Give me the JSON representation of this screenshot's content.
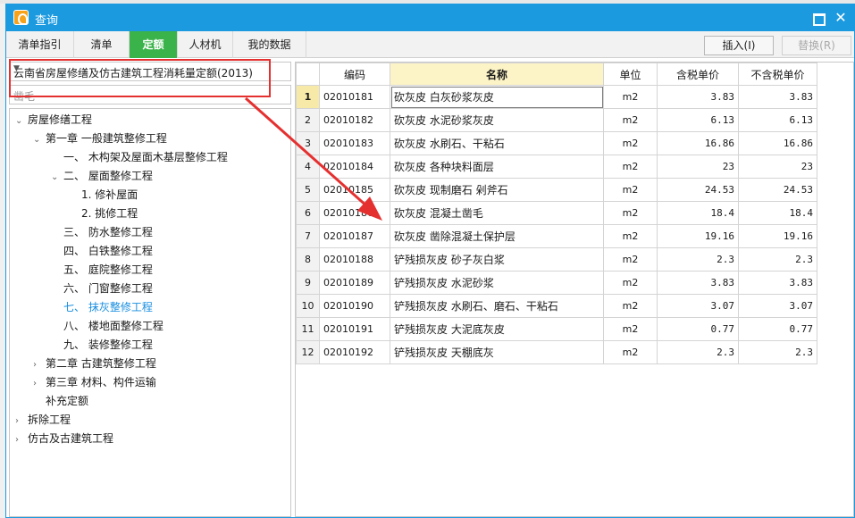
{
  "window": {
    "title": "查询"
  },
  "tabs": [
    "清单指引",
    "清单",
    "定额",
    "人材机",
    "我的数据"
  ],
  "active_tab": 2,
  "buttons": {
    "insert": "插入(I)",
    "replace": "替换(R)"
  },
  "library": {
    "selected": "云南省房屋修缮及仿古建筑工程消耗量定额(2013)"
  },
  "search": {
    "value": "凿毛"
  },
  "tree": [
    {
      "level": 0,
      "arrow": "down",
      "label": "房屋修缮工程"
    },
    {
      "level": 1,
      "arrow": "down",
      "label": "第一章 一般建筑整修工程"
    },
    {
      "level": 2,
      "arrow": "",
      "label": "一、 木构架及屋面木基层整修工程"
    },
    {
      "level": 2,
      "arrow": "down",
      "label": "二、 屋面整修工程"
    },
    {
      "level": 3,
      "arrow": "",
      "label": "1. 修补屋面"
    },
    {
      "level": 3,
      "arrow": "",
      "label": "2. 挑修工程"
    },
    {
      "level": 2,
      "arrow": "",
      "label": "三、 防水整修工程"
    },
    {
      "level": 2,
      "arrow": "",
      "label": "四、 白铁整修工程"
    },
    {
      "level": 2,
      "arrow": "",
      "label": "五、 庭院整修工程"
    },
    {
      "level": 2,
      "arrow": "",
      "label": "六、 门窗整修工程"
    },
    {
      "level": 2,
      "arrow": "",
      "label": "七、 抹灰整修工程",
      "selected": true
    },
    {
      "level": 2,
      "arrow": "",
      "label": "八、 楼地面整修工程"
    },
    {
      "level": 2,
      "arrow": "",
      "label": "九、 装修整修工程"
    },
    {
      "level": 1,
      "arrow": "right",
      "label": "第二章 古建筑整修工程"
    },
    {
      "level": 1,
      "arrow": "right",
      "label": "第三章 材料、构件运输"
    },
    {
      "level": 1,
      "arrow": "",
      "label": "补充定额"
    },
    {
      "level": 0,
      "arrow": "right",
      "label": "拆除工程"
    },
    {
      "level": 0,
      "arrow": "right",
      "label": "仿古及古建筑工程"
    }
  ],
  "grid": {
    "headers": [
      "编码",
      "名称",
      "单位",
      "含税单价",
      "不含税单价"
    ],
    "rows": [
      [
        "1",
        "02010181",
        "砍灰皮 白灰砂浆灰皮",
        "m2",
        "3.83",
        "3.83"
      ],
      [
        "2",
        "02010182",
        "砍灰皮 水泥砂浆灰皮",
        "m2",
        "6.13",
        "6.13"
      ],
      [
        "3",
        "02010183",
        "砍灰皮 水刷石、干粘石",
        "m2",
        "16.86",
        "16.86"
      ],
      [
        "4",
        "02010184",
        "砍灰皮 各种块料面层",
        "m2",
        "23",
        "23"
      ],
      [
        "5",
        "02010185",
        "砍灰皮 现制磨石 剁斧石",
        "m2",
        "24.53",
        "24.53"
      ],
      [
        "6",
        "02010186",
        "砍灰皮 混凝土凿毛",
        "m2",
        "18.4",
        "18.4"
      ],
      [
        "7",
        "02010187",
        "砍灰皮 凿除混凝土保护层",
        "m2",
        "19.16",
        "19.16"
      ],
      [
        "8",
        "02010188",
        "铲残损灰皮 砂子灰白浆",
        "m2",
        "2.3",
        "2.3"
      ],
      [
        "9",
        "02010189",
        "铲残损灰皮 水泥砂浆",
        "m2",
        "3.83",
        "3.83"
      ],
      [
        "10",
        "02010190",
        "铲残损灰皮 水刷石、磨石、干粘石",
        "m2",
        "3.07",
        "3.07"
      ],
      [
        "11",
        "02010191",
        "铲残损灰皮 大泥底灰皮",
        "m2",
        "0.77",
        "0.77"
      ],
      [
        "12",
        "02010192",
        "铲残损灰皮 天棚底灰",
        "m2",
        "2.3",
        "2.3"
      ]
    ]
  },
  "colors": {
    "titlebar": "#1b9ae0",
    "active_tab": "#3ab34a",
    "annotation": "#e53030",
    "selected_tree": "#1a8fe0"
  }
}
